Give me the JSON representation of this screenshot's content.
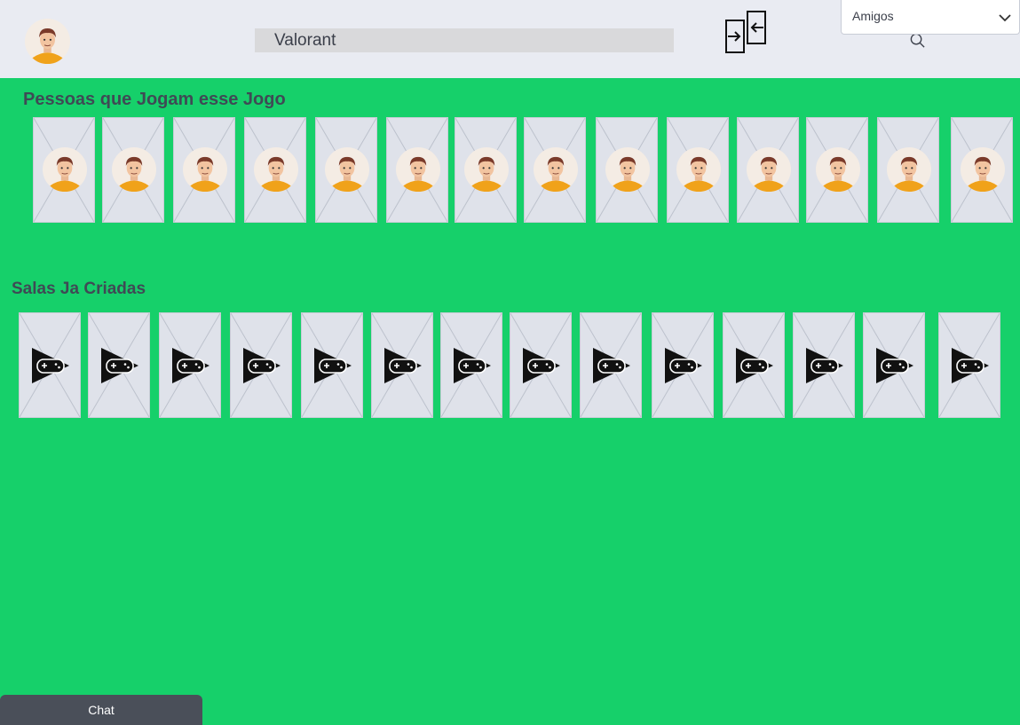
{
  "header": {
    "search": {
      "value": "Valorant",
      "placeholder": ""
    },
    "friends_dropdown": {
      "selected": "Amigos"
    }
  },
  "sections": {
    "people": {
      "title": "Pessoas que Jogam esse Jogo",
      "count": 14
    },
    "rooms": {
      "title": "Salas Ja Criadas",
      "count": 14
    }
  },
  "chat": {
    "label": "Chat"
  },
  "colors": {
    "background": "#16d06a",
    "header": "#e9ebf2",
    "card": "#dfe2ea",
    "chat_bar": "#4a4f59",
    "title_text": "#3f4a55"
  },
  "icons": {
    "user_avatar": "user-avatar-icon",
    "search": "search-icon",
    "swap": "swap-arrows-icon",
    "dropdown": "chevron-down-icon",
    "room": "game-controller-icon"
  }
}
